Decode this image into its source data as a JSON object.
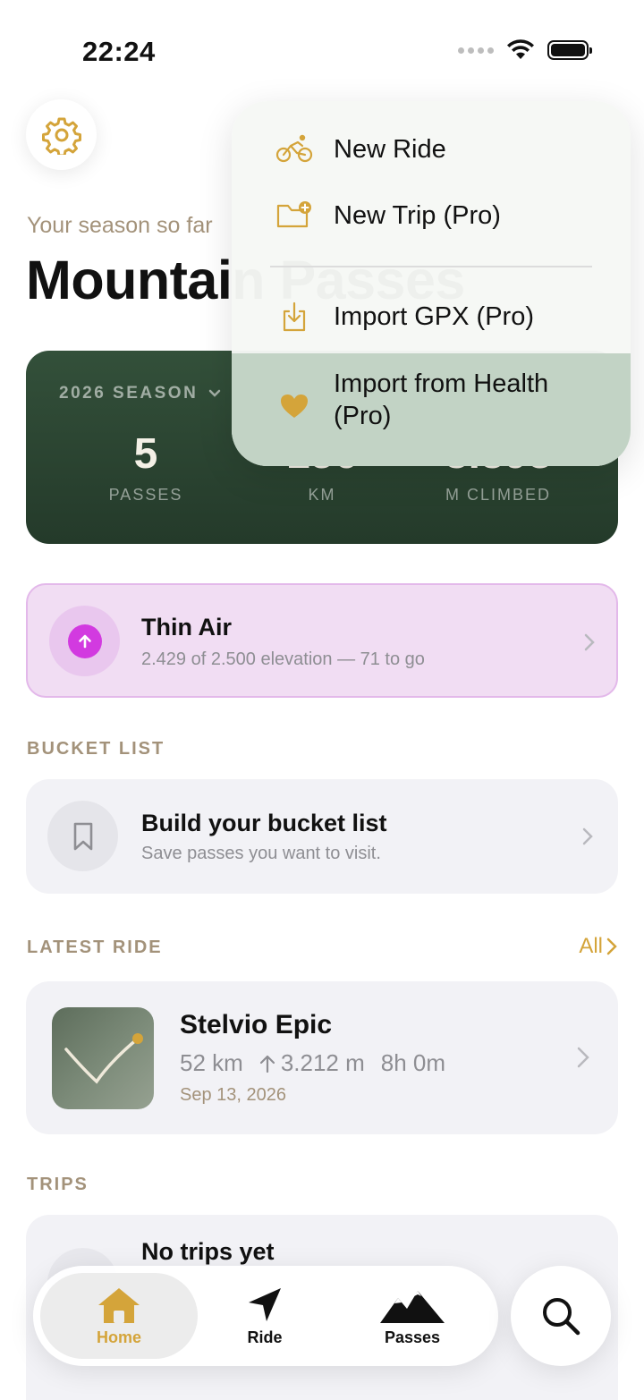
{
  "status_bar": {
    "time": "22:24"
  },
  "header": {
    "subtitle": "Your season so far",
    "title": "Mountain Passes"
  },
  "season": {
    "label": "2026 SEASON",
    "stats": [
      {
        "value": "5",
        "label": "PASSES"
      },
      {
        "value": "156",
        "label": "KM"
      },
      {
        "value": "3.398",
        "label": "M CLIMBED"
      }
    ]
  },
  "achievement": {
    "title": "Thin Air",
    "subtitle": "2.429 of 2.500 elevation — 71 to go",
    "progress_fraction": 0.9716
  },
  "bucket_list": {
    "section_label": "BUCKET LIST",
    "title": "Build your bucket list",
    "subtitle": "Save passes you want to visit."
  },
  "latest_ride": {
    "section_label": "LATEST RIDE",
    "all_link": "All",
    "title": "Stelvio Epic",
    "distance": "52 km",
    "elevation": "3.212 m",
    "duration": "8h 0m",
    "date": "Sep 13, 2026"
  },
  "trips": {
    "section_label": "TRIPS",
    "title": "No trips yet"
  },
  "menu": {
    "items": [
      {
        "label": "New Ride",
        "icon": "bicycle-icon"
      },
      {
        "label": "New Trip (Pro)",
        "icon": "folder-plus-icon"
      },
      {
        "label": "Import GPX (Pro)",
        "icon": "import-icon"
      },
      {
        "label": "Import from Health (Pro)",
        "icon": "heart-icon"
      }
    ]
  },
  "tab_bar": {
    "tabs": [
      {
        "label": "Home",
        "icon": "house-icon"
      },
      {
        "label": "Ride",
        "icon": "navigation-arrow-icon"
      },
      {
        "label": "Passes",
        "icon": "mountains-icon"
      }
    ]
  },
  "colors": {
    "accent": "#d4a43a",
    "season_card": "#2c4632",
    "achievement_bg": "#f1ddf3",
    "achievement_icon": "#d23ae0"
  }
}
